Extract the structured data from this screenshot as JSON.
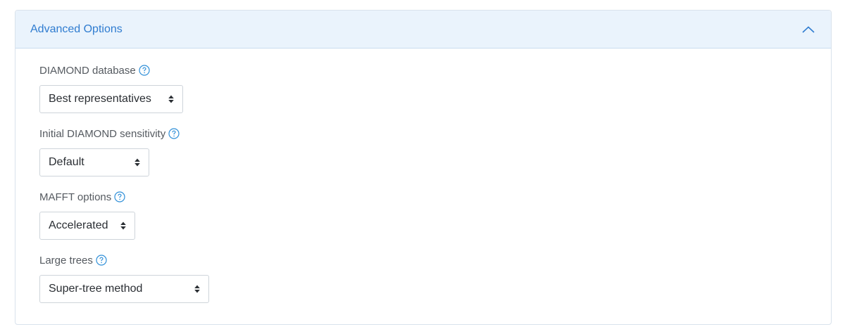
{
  "panel": {
    "title": "Advanced Options",
    "expanded": true,
    "toggle_icon": "chevron-up-icon",
    "accent_color": "#2f7cd0",
    "header_bg": "#eaf3fc"
  },
  "fields": {
    "diamond_db": {
      "label": "DIAMOND database",
      "help_icon": "question-circle-icon",
      "selected": "Best representatives"
    },
    "diamond_sensitivity": {
      "label": "Initial DIAMOND sensitivity",
      "help_icon": "question-circle-icon",
      "selected": "Default"
    },
    "mafft": {
      "label": "MAFFT options",
      "help_icon": "question-circle-icon",
      "selected": "Accelerated"
    },
    "large_trees": {
      "label": "Large trees",
      "help_icon": "question-circle-icon",
      "selected": "Super-tree method"
    }
  }
}
